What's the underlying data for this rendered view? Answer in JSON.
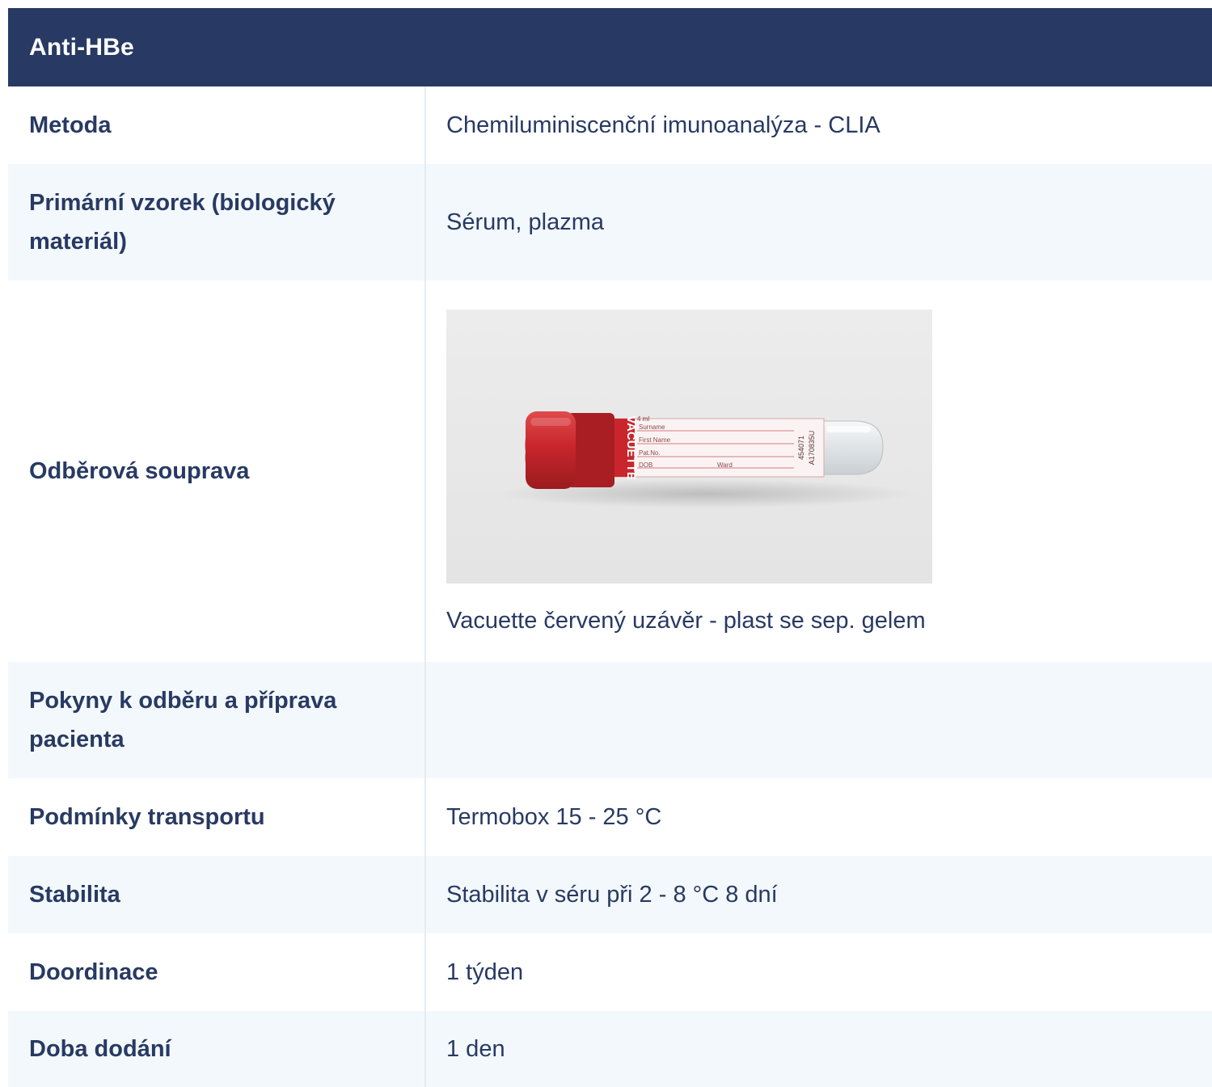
{
  "title": "Anti-HBe",
  "rows": [
    {
      "label": "Metoda",
      "value": "Chemiluminiscenční imunoanalýza - CLIA"
    },
    {
      "label": "Primární vzorek (biologický materiál)",
      "value": "Sérum, plazma"
    },
    {
      "label": "Odběrová souprava",
      "value": "Vacuette červený uzávěr - plast se sep. gelem"
    },
    {
      "label": "Pokyny k odběru a příprava pacienta",
      "value": ""
    },
    {
      "label": "Podmínky transportu",
      "value": "Termobox 15 - 25 °C"
    },
    {
      "label": "Stabilita",
      "value": "Stabilita v séru při 2 - 8 °C 8 dní"
    },
    {
      "label": "Doordinace",
      "value": "1 týden"
    },
    {
      "label": "Doba dodání",
      "value": "1 den"
    }
  ],
  "tube_label": {
    "brand": "VACUETTE",
    "volume": "4 ml",
    "fields": [
      "Surname",
      "First Name",
      "Pat.No.",
      "DOB",
      "Ward"
    ],
    "codes": [
      "454071",
      "A170835U"
    ]
  },
  "colors": {
    "header_bg": "#283a63",
    "text": "#283a63",
    "row_alt_bg": "#f3f8fc",
    "cap_red": "#c8262c"
  },
  "icons": {
    "tube": "blood-collection-tube-image"
  }
}
